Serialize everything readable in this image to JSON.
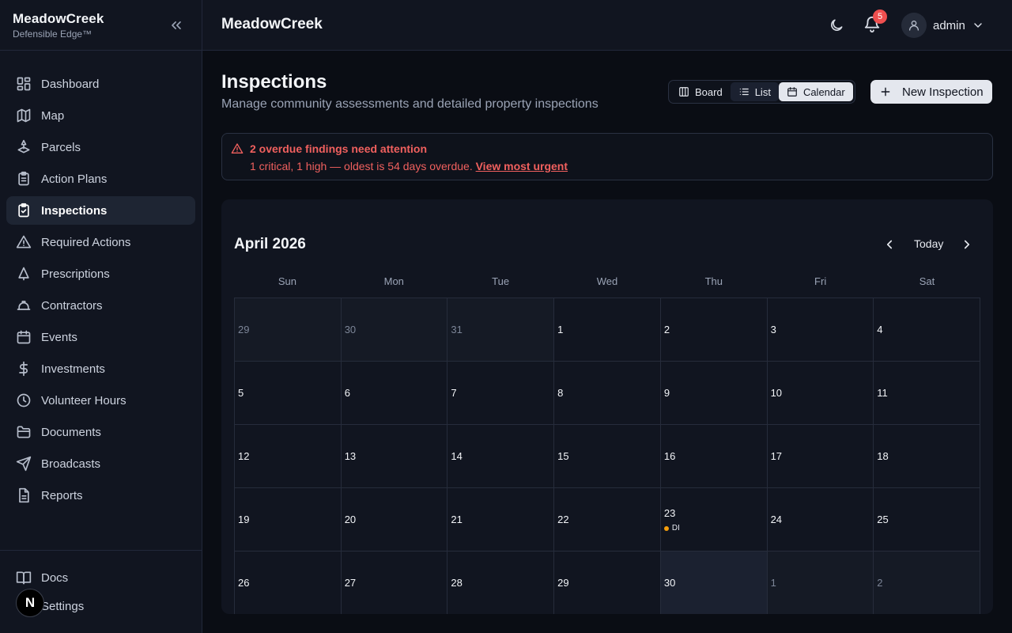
{
  "sidebar": {
    "brand": "MeadowCreek",
    "tagline": "Defensible Edge™",
    "items": [
      {
        "label": "Dashboard"
      },
      {
        "label": "Map"
      },
      {
        "label": "Parcels"
      },
      {
        "label": "Action Plans"
      },
      {
        "label": "Inspections"
      },
      {
        "label": "Required Actions"
      },
      {
        "label": "Prescriptions"
      },
      {
        "label": "Contractors"
      },
      {
        "label": "Events"
      },
      {
        "label": "Investments"
      },
      {
        "label": "Volunteer Hours"
      },
      {
        "label": "Documents"
      },
      {
        "label": "Broadcasts"
      },
      {
        "label": "Reports"
      }
    ],
    "bottom_items": [
      {
        "label": "Docs"
      },
      {
        "label": "Settings"
      }
    ],
    "avatar_letter": "N"
  },
  "topbar": {
    "title": "MeadowCreek",
    "notification_count": "5",
    "user": "admin"
  },
  "page": {
    "title": "Inspections",
    "subtitle": "Manage community assessments and detailed property inspections"
  },
  "views": {
    "board": "Board",
    "list": "List",
    "calendar": "Calendar",
    "active": "Calendar"
  },
  "new_button": "New Inspection",
  "alert": {
    "title": "2 overdue findings need attention",
    "body": "1 critical, 1 high — oldest is 54 days overdue.",
    "link": "View most urgent"
  },
  "calendar": {
    "month": "April 2026",
    "today_label": "Today",
    "weekdays": [
      "Sun",
      "Mon",
      "Tue",
      "Wed",
      "Thu",
      "Fri",
      "Sat"
    ],
    "weeks": [
      [
        {
          "d": "29",
          "out": true
        },
        {
          "d": "30",
          "out": true
        },
        {
          "d": "31",
          "out": true
        },
        {
          "d": "1"
        },
        {
          "d": "2"
        },
        {
          "d": "3"
        },
        {
          "d": "4"
        }
      ],
      [
        {
          "d": "5"
        },
        {
          "d": "6"
        },
        {
          "d": "7"
        },
        {
          "d": "8"
        },
        {
          "d": "9"
        },
        {
          "d": "10"
        },
        {
          "d": "11"
        }
      ],
      [
        {
          "d": "12"
        },
        {
          "d": "13"
        },
        {
          "d": "14"
        },
        {
          "d": "15"
        },
        {
          "d": "16"
        },
        {
          "d": "17"
        },
        {
          "d": "18"
        }
      ],
      [
        {
          "d": "19"
        },
        {
          "d": "20"
        },
        {
          "d": "21"
        },
        {
          "d": "22"
        },
        {
          "d": "23",
          "event": "DI"
        },
        {
          "d": "24"
        },
        {
          "d": "25"
        }
      ],
      [
        {
          "d": "26"
        },
        {
          "d": "27"
        },
        {
          "d": "28"
        },
        {
          "d": "29"
        },
        {
          "d": "30",
          "today": true
        },
        {
          "d": "1",
          "out": true
        },
        {
          "d": "2",
          "out": true
        }
      ]
    ],
    "event_color": "#f59e0b"
  },
  "colors": {
    "accent_alert": "#f0605e",
    "badge": "#ef4f4f",
    "background": "#0a0d14",
    "surface": "#111520"
  }
}
